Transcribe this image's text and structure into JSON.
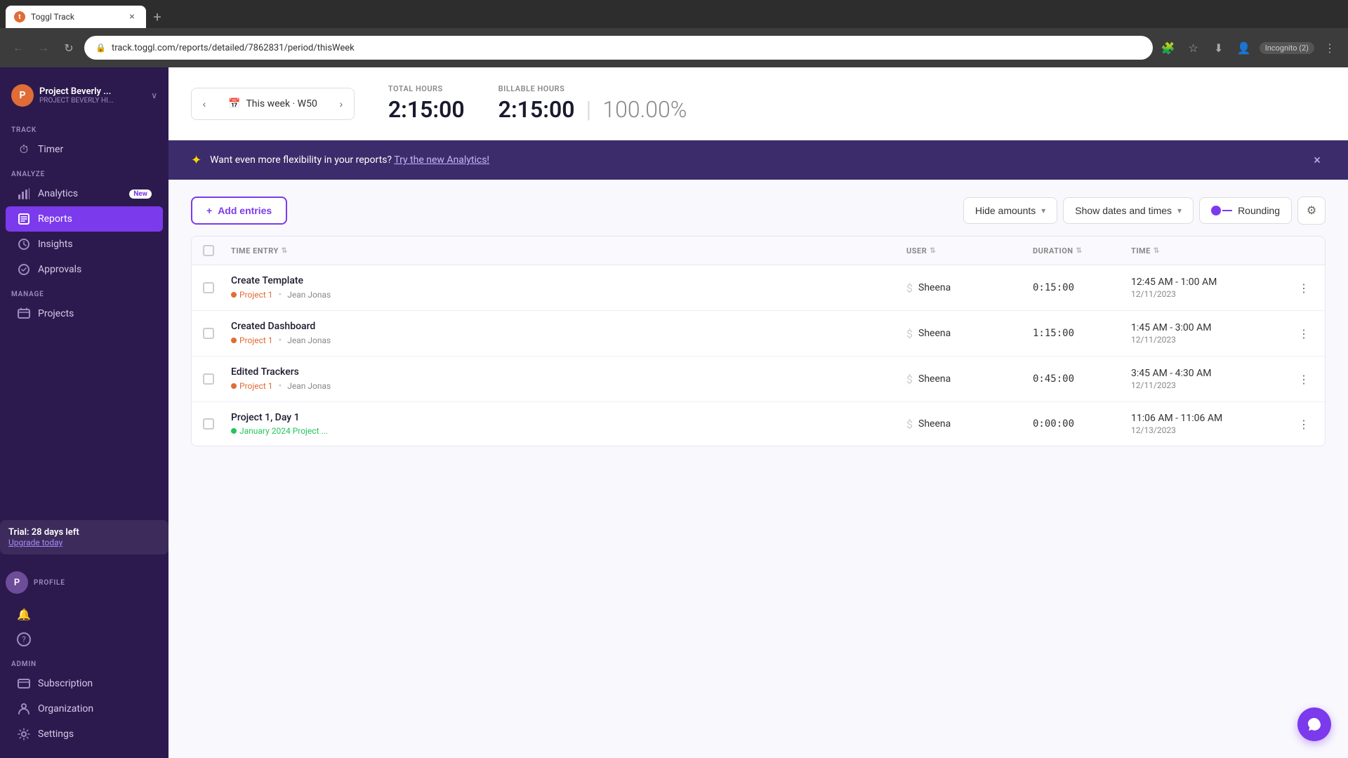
{
  "browser": {
    "tab_favicon": "T",
    "tab_title": "Toggl Track",
    "tab_close": "×",
    "tab_new": "+",
    "nav_back": "←",
    "nav_forward": "→",
    "nav_refresh": "↺",
    "address_lock": "🔒",
    "address_url": "track.toggl.com/reports/detailed/7862831/period/thisWeek",
    "incognito": "Incognito (2)"
  },
  "sidebar": {
    "workspace_initial": "P",
    "workspace_name": "Project Beverly ...",
    "workspace_sub": "PROJECT BEVERLY HI...",
    "workspace_chevron": "∨",
    "section_track": "TRACK",
    "timer_label": "Timer",
    "section_analyze": "ANALYZE",
    "analytics_label": "Analytics",
    "analytics_badge": "New",
    "reports_label": "Reports",
    "insights_label": "Insights",
    "approvals_label": "Approvals",
    "section_manage": "MANAGE",
    "projects_label": "Projects",
    "trial_title": "Trial: 28 days left",
    "trial_link": "Upgrade today",
    "profile_initial": "P",
    "profile_label": "PROFILE",
    "section_admin": "ADMIN",
    "subscription_label": "Subscription",
    "organization_label": "Organization",
    "settings_label": "Settings",
    "help_icon": "?"
  },
  "header": {
    "prev_btn": "‹",
    "next_btn": "›",
    "week_icon": "📅",
    "week_label": "This week · W50",
    "total_hours_label": "TOTAL HOURS",
    "total_hours_value": "2:15:00",
    "billable_hours_label": "BILLABLE HOURS",
    "billable_hours_value": "2:15:00",
    "billable_percent": "100.00%"
  },
  "banner": {
    "icon": "✦",
    "text": "Want even more flexibility in your reports?",
    "link_text": "Try the new Analytics!",
    "close": "×"
  },
  "toolbar": {
    "add_entries_plus": "+",
    "add_entries_label": "Add entries",
    "hide_amounts_label": "Hide amounts",
    "show_dates_label": "Show dates and times",
    "rounding_label": "Rounding",
    "settings_icon": "⚙"
  },
  "table": {
    "col_checkbox": "",
    "col_time_entry": "TIME ENTRY",
    "col_user": "USER",
    "col_duration": "DURATION",
    "col_time": "TIME",
    "col_actions": "",
    "rows": [
      {
        "name": "Create Template",
        "project": "Project 1",
        "project_color": "#e06c37",
        "user_tag": "Jean Jonas",
        "billable": true,
        "user": "Sheena",
        "duration": "0:15:00",
        "time_range": "12:45 AM - 1:00 AM",
        "date": "12/11/2023"
      },
      {
        "name": "Created Dashboard",
        "project": "Project 1",
        "project_color": "#e06c37",
        "user_tag": "Jean Jonas",
        "billable": true,
        "user": "Sheena",
        "duration": "1:15:00",
        "time_range": "1:45 AM - 3:00 AM",
        "date": "12/11/2023"
      },
      {
        "name": "Edited Trackers",
        "project": "Project 1",
        "project_color": "#e06c37",
        "user_tag": "Jean Jonas",
        "billable": true,
        "user": "Sheena",
        "duration": "0:45:00",
        "time_range": "3:45 AM - 4:30 AM",
        "date": "12/11/2023"
      },
      {
        "name": "Project 1, Day 1",
        "project": "January 2024 Project ...",
        "project_color": "#22c55e",
        "user_tag": "",
        "billable": true,
        "user": "Sheena",
        "duration": "0:00:00",
        "time_range": "11:06 AM - 11:06 AM",
        "date": "12/13/2023"
      }
    ]
  },
  "chat": {
    "icon": "💬"
  }
}
